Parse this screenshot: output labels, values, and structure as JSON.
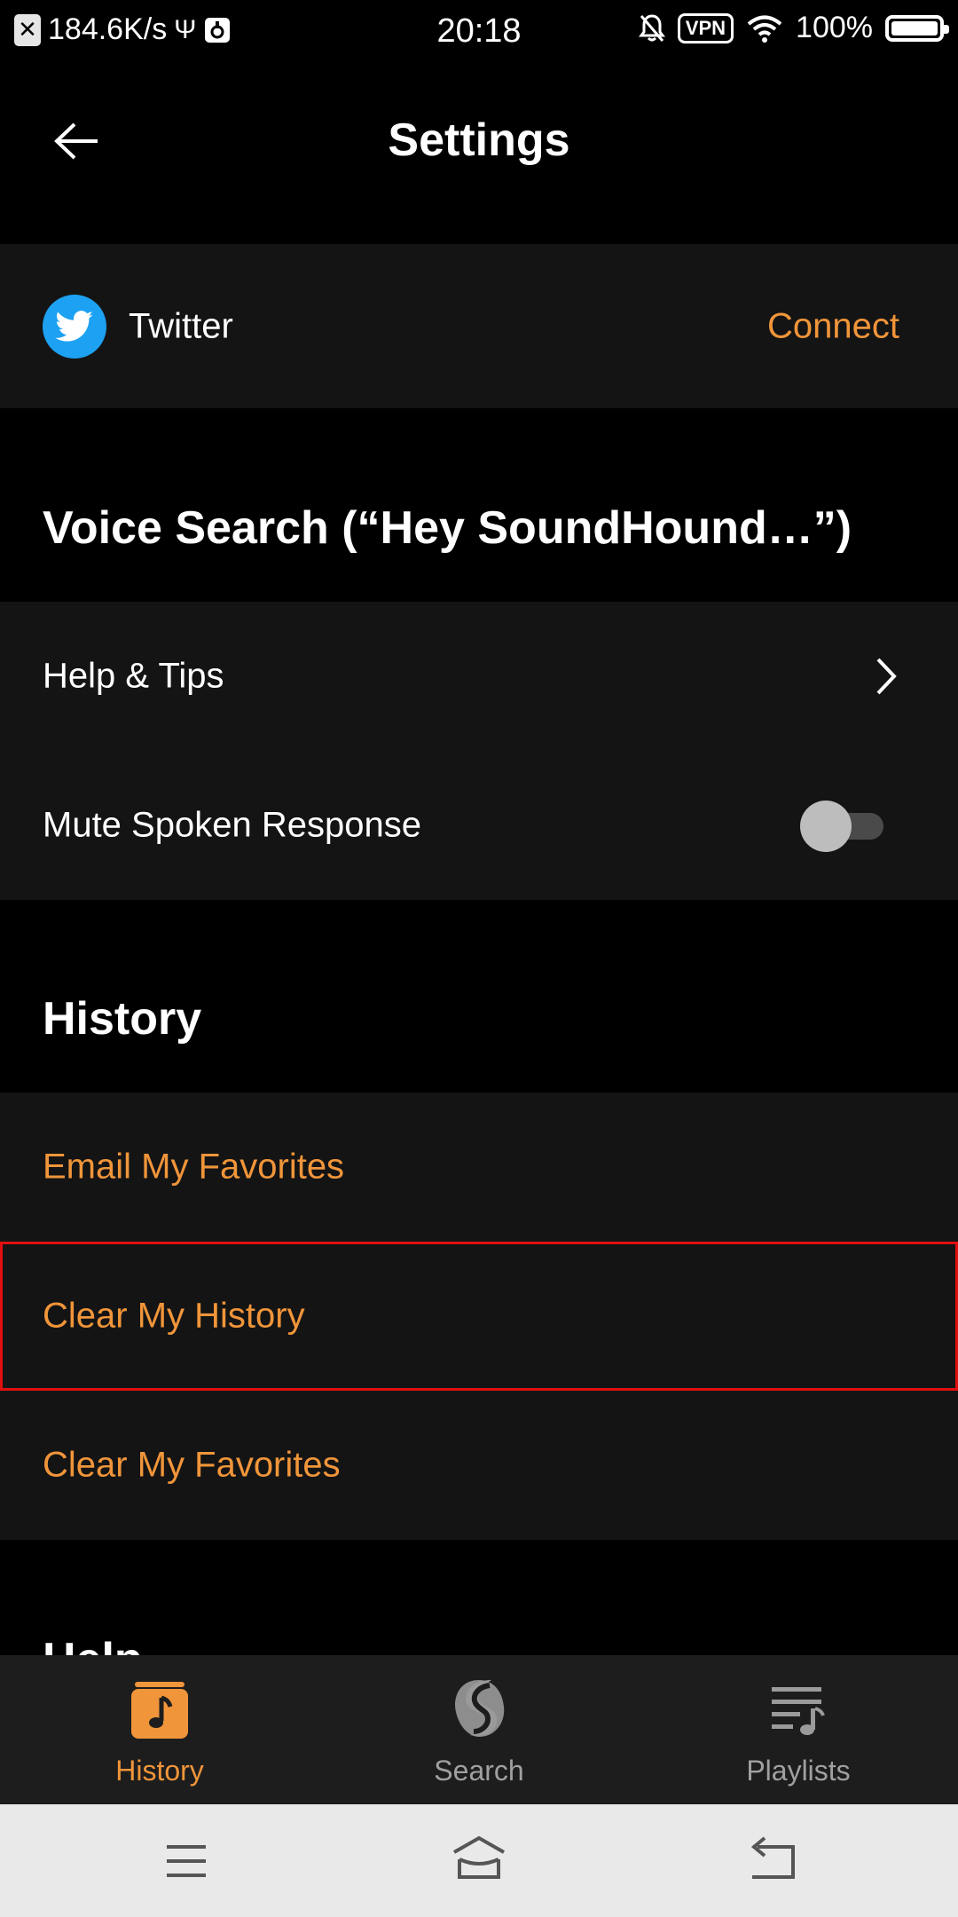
{
  "status_bar": {
    "speed": "184.6K/s",
    "time": "20:18",
    "vpn": "VPN",
    "battery": "100%"
  },
  "header": {
    "title": "Settings"
  },
  "twitter": {
    "label": "Twitter",
    "action": "Connect"
  },
  "voice_search": {
    "title": "Voice Search (“Hey SoundHound…”)",
    "items": [
      {
        "label": "Help & Tips"
      },
      {
        "label": "Mute Spoken Response",
        "toggle_on": false
      }
    ]
  },
  "history": {
    "title": "History",
    "items": [
      {
        "label": "Email My Favorites"
      },
      {
        "label": "Clear My History"
      },
      {
        "label": "Clear My Favorites"
      }
    ]
  },
  "next_section": {
    "title": "Help"
  },
  "bottom_nav": {
    "items": [
      {
        "label": "History",
        "active": true,
        "icon": "music-note-icon"
      },
      {
        "label": "Search",
        "active": false,
        "icon": "soundhound-icon"
      },
      {
        "label": "Playlists",
        "active": false,
        "icon": "playlist-icon"
      }
    ]
  },
  "colors": {
    "accent": "#f0953a",
    "background": "#000000",
    "panel": "#141414",
    "twitter_blue": "#1da1f2",
    "highlight": "#e01010"
  }
}
